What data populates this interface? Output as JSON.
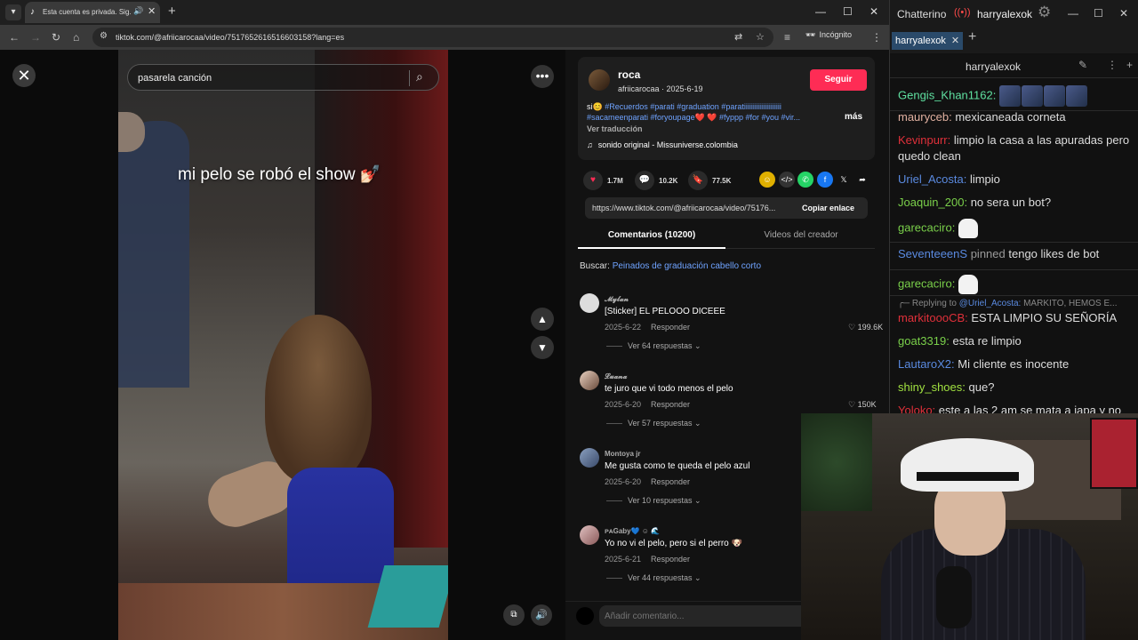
{
  "browser": {
    "tab_title": "Esta cuenta es privada. Sig...",
    "tab_icon": "tiktok-icon",
    "url": "tiktok.com/@afriicarocaa/video/7517652616516603158?lang=es",
    "incognito_label": "Incógnito"
  },
  "video": {
    "search_query": "pasarela canción",
    "caption": "mi pelo se robó el show 💅🏻"
  },
  "post": {
    "author_name": "roca",
    "author_handle": "afriicarocaa · 2025-6-19",
    "follow_label": "Seguir",
    "desc_prefix": "si😊 ",
    "desc_tags": "#Recuerdos #parati #graduation #paratiiiiiiiiiiiiiiiiiiiii #sacameenparati #foryoupage❤️ ❤️ #fyppp #for #you #vir...",
    "more_label": "más",
    "translate_label": "Ver traducción",
    "sound": "sonido original - Missuniverse.colombia",
    "likes": "1.7M",
    "comments_count": "10.2K",
    "saves": "77.5K",
    "link": "https://www.tiktok.com/@afriicarocaa/video/75176...",
    "copy_label": "Copiar enlace"
  },
  "tabs": {
    "comments": "Comentarios (10200)",
    "creator": "Videos del creador"
  },
  "related_search": {
    "prefix": "Buscar: ",
    "query": "Peinados de graduación cabello corto"
  },
  "comments": [
    {
      "user": "𝓜𝔂𝓵𝓪𝓷",
      "text": "[Sticker] EL PELOOO DICEEE",
      "date": "2025-6-22",
      "reply": "Responder",
      "likes": "199.6K",
      "replies": "Ver 64 respuestas"
    },
    {
      "user": "𝓛𝓾𝓪𝓷𝓪",
      "text": "te juro que vi todo menos el pelo",
      "date": "2025-6-20",
      "reply": "Responder",
      "likes": "150K",
      "replies": "Ver 57 respuestas"
    },
    {
      "user": "Montoya jr",
      "text": "Me gusta como te queda el pelo azul",
      "date": "2025-6-20",
      "reply": "Responder",
      "likes": "",
      "replies": "Ver 10 respuestas"
    },
    {
      "user": "ᴘᴀGaby💙 ☺ 🌊",
      "text": "Yo no vi el pelo, pero si el perro 🐶",
      "date": "2025-6-21",
      "reply": "Responder",
      "likes": "",
      "replies": "Ver 44 respuestas"
    }
  ],
  "add_comment_placeholder": "Añadir comentario...",
  "chat": {
    "app_title": "Chatterino",
    "account": "harryalexok",
    "tab_label": "harryalexok",
    "channel": "harryalexok",
    "messages": [
      {
        "user": "Gengis_Khan1162:",
        "color": "#5fe0a0",
        "text": ""
      },
      {
        "user": "mauryceb:",
        "color": "#e0b0a0",
        "text": "mexicaneada corneta"
      },
      {
        "user": "Kevinpurr:",
        "color": "#e0303a",
        "text": "limpio la casa a las apuradas pero quedo clean"
      },
      {
        "user": "Uriel_Acosta:",
        "color": "#5a8ae0",
        "text": "limpio"
      },
      {
        "user": "Joaquin_200:",
        "color": "#7ad04a",
        "text": "no sera un bot?"
      },
      {
        "user": "garecaciro:",
        "color": "#7ad04a",
        "text": ""
      },
      {
        "user": "SeventeeenS",
        "color": "#5a8ae0",
        "pinned": "pinned",
        "text": "tengo likes de bot"
      },
      {
        "user": "garecaciro:",
        "color": "#7ad04a",
        "text": ""
      },
      {
        "user": "markitoooCB:",
        "color": "#e0303a",
        "text": "ESTA LIMPIO SU SEÑORÍA"
      },
      {
        "user": "goat3319:",
        "color": "#7ad04a",
        "text": "esta re limpio"
      },
      {
        "user": "LautaroX2:",
        "color": "#5a8ae0",
        "text": "Mi cliente es inocente"
      },
      {
        "user": "shiny_shoes:",
        "color": "#a0e040",
        "text": "que?"
      },
      {
        "user": "Yoloko:",
        "color": "#e0303a",
        "text": "este a las 2 am se mata a japa y no"
      }
    ],
    "reply_prefix": "Replying to ",
    "reply_user": "@Uriel_Acosta:",
    "reply_text": " MARKITO, HEMOS E..."
  }
}
